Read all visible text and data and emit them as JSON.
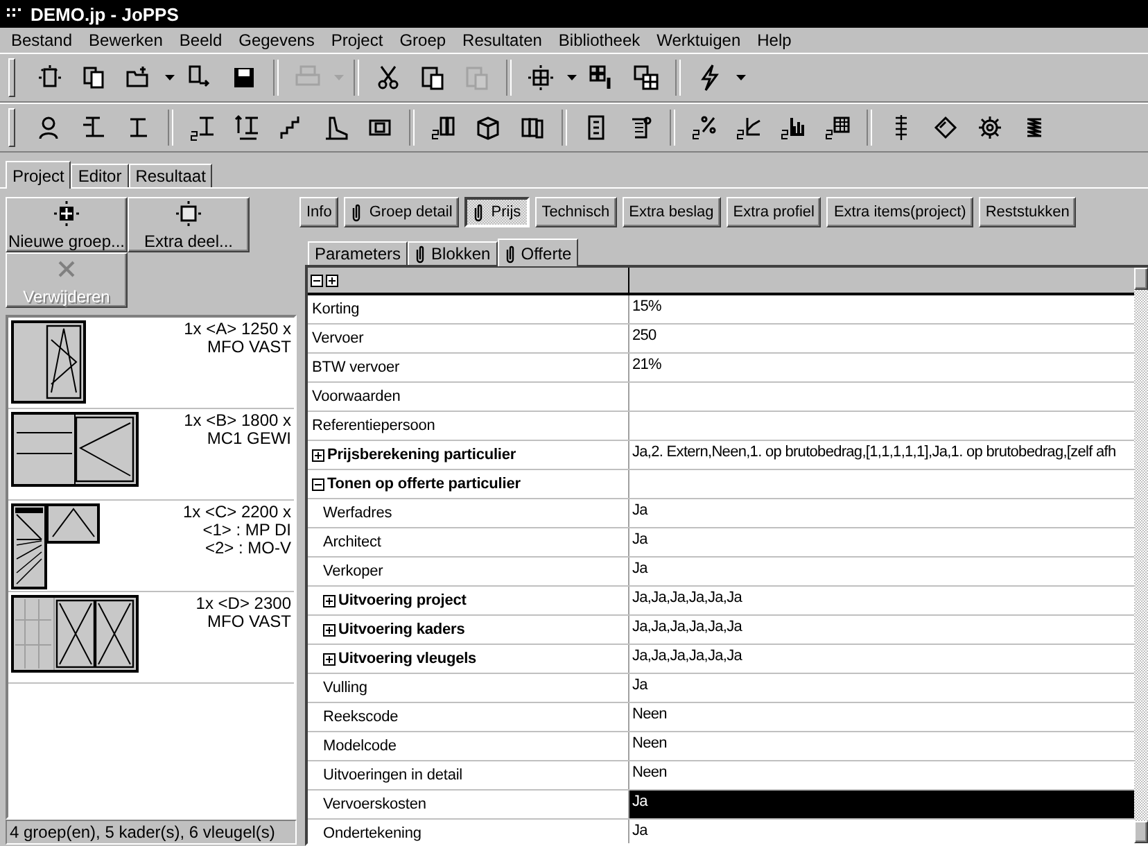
{
  "window": {
    "title": "DEMO.jp - JoPPS"
  },
  "menu": [
    "Bestand",
    "Bewerken",
    "Beeld",
    "Gegevens",
    "Project",
    "Groep",
    "Resultaten",
    "Bibliotheek",
    "Werktuigen",
    "Help"
  ],
  "toolbar_1": [
    {
      "kind": "new",
      "disabled": false
    },
    {
      "kind": "copy",
      "disabled": false
    },
    {
      "kind": "open",
      "disabled": false
    },
    {
      "kind": "dropdown",
      "disabled": false
    },
    {
      "kind": "import",
      "disabled": false
    },
    {
      "kind": "save",
      "disabled": false
    },
    {
      "kind": "sep"
    },
    {
      "kind": "print",
      "disabled": true
    },
    {
      "kind": "dropdown",
      "disabled": true
    },
    {
      "kind": "sep"
    },
    {
      "kind": "cut",
      "disabled": false
    },
    {
      "kind": "paste",
      "disabled": false
    },
    {
      "kind": "paste",
      "disabled": true
    },
    {
      "kind": "sep"
    },
    {
      "kind": "grid-new",
      "disabled": false
    },
    {
      "kind": "dropdown",
      "disabled": false
    },
    {
      "kind": "grid-info",
      "disabled": false
    },
    {
      "kind": "grid-multi",
      "disabled": false
    },
    {
      "kind": "sep"
    },
    {
      "kind": "lightning",
      "disabled": false
    },
    {
      "kind": "dropdown",
      "disabled": false
    }
  ],
  "toolbar_2": [
    {
      "kind": "person"
    },
    {
      "kind": "profile-frame"
    },
    {
      "kind": "profile"
    },
    {
      "kind": "sep"
    },
    {
      "kind": "price-profile"
    },
    {
      "kind": "size-profile"
    },
    {
      "kind": "stairs"
    },
    {
      "kind": "shoe"
    },
    {
      "kind": "frame"
    },
    {
      "kind": "sep"
    },
    {
      "kind": "price-bars"
    },
    {
      "kind": "cube"
    },
    {
      "kind": "rolls"
    },
    {
      "kind": "sep"
    },
    {
      "kind": "document"
    },
    {
      "kind": "scroll"
    },
    {
      "kind": "sep"
    },
    {
      "kind": "price-percent"
    },
    {
      "kind": "price-line"
    },
    {
      "kind": "price-chart"
    },
    {
      "kind": "price-grid"
    },
    {
      "kind": "sep"
    },
    {
      "kind": "list"
    },
    {
      "kind": "diamond"
    },
    {
      "kind": "gear"
    },
    {
      "kind": "spring"
    }
  ],
  "main_tabs": [
    {
      "label": "Project",
      "selected": true
    },
    {
      "label": "Editor",
      "selected": false
    },
    {
      "label": "Resultaat",
      "selected": false
    }
  ],
  "left_buttons": [
    {
      "label": "Nieuwe groep...",
      "kind": "grid",
      "disabled": false
    },
    {
      "label": "Extra deel...",
      "kind": "square",
      "disabled": false
    },
    {
      "label": "Verwijderen",
      "kind": "cross",
      "disabled": true
    }
  ],
  "groups": [
    {
      "kind": "tilt",
      "lines": [
        "1x <A> 1250 x",
        "MFO VAST"
      ]
    },
    {
      "kind": "slide",
      "lines": [
        "1x <B> 1800 x",
        "MC1 GEWI"
      ]
    },
    {
      "kind": "combo",
      "lines": [
        "1x <C> 2200 x",
        "<1> : MP DI",
        "<2> : MO-V"
      ]
    },
    {
      "kind": "double",
      "lines": [
        "1x <D> 2300",
        "MFO VAST"
      ]
    }
  ],
  "status_bar": "4 groep(en), 5 kader(s), 6 vleugel(s)",
  "detail_buttons": [
    {
      "label": "Info",
      "clip": false,
      "selected": false
    },
    {
      "label": "Groep detail",
      "clip": true,
      "selected": false
    },
    {
      "label": "Prijs",
      "clip": true,
      "selected": true
    },
    {
      "label": "Technisch",
      "clip": false,
      "selected": false
    },
    {
      "label": "Extra beslag",
      "clip": false,
      "selected": false
    },
    {
      "label": "Extra profiel",
      "clip": false,
      "selected": false
    },
    {
      "label": "Extra items(project)",
      "clip": false,
      "selected": false
    },
    {
      "label": "Reststukken",
      "clip": false,
      "selected": false
    }
  ],
  "sub_tabs": [
    {
      "label": "Parameters",
      "clip": false,
      "selected": false
    },
    {
      "label": "Blokken",
      "clip": true,
      "selected": false
    },
    {
      "label": "Offerte",
      "clip": true,
      "selected": true
    }
  ],
  "grid": {
    "rows": [
      {
        "kind": "property",
        "label": "Korting",
        "value": "15%",
        "selected": false
      },
      {
        "kind": "property",
        "label": "Vervoer",
        "value": "250",
        "selected": false
      },
      {
        "kind": "property",
        "label": "BTW vervoer",
        "value": "21%",
        "selected": false
      },
      {
        "kind": "property",
        "label": "Voorwaarden",
        "selected": false
      },
      {
        "kind": "property",
        "label": "Referentiepersoon",
        "selected": false
      },
      {
        "kind": "group",
        "label": "Prijsberekening particulier",
        "value": "Ja,2. Extern,Neen,1. op brutobedrag,[1,1,1,1,1],Ja,1. op brutobedrag,[zelf afh",
        "expanded": false,
        "selected": false
      },
      {
        "kind": "group",
        "label": "Tonen op offerte particulier",
        "expanded": true,
        "selected": false,
        "children": [
          {
            "kind": "property",
            "label": "Werfadres",
            "value": "Ja",
            "selected": false
          },
          {
            "kind": "property",
            "label": "Architect",
            "value": "Ja",
            "selected": false
          },
          {
            "kind": "property",
            "label": "Verkoper",
            "value": "Ja",
            "selected": false
          },
          {
            "kind": "group",
            "label": "Uitvoering project",
            "value": "Ja,Ja,Ja,Ja,Ja,Ja",
            "expanded": false,
            "selected": false
          },
          {
            "kind": "group",
            "label": "Uitvoering kaders",
            "value": "Ja,Ja,Ja,Ja,Ja,Ja",
            "expanded": false,
            "selected": false
          },
          {
            "kind": "group",
            "label": "Uitvoering vleugels",
            "value": "Ja,Ja,Ja,Ja,Ja,Ja",
            "expanded": false,
            "selected": false
          },
          {
            "kind": "property",
            "label": "Vulling",
            "value": "Ja",
            "selected": false
          },
          {
            "kind": "property",
            "label": "Reekscode",
            "value": "Neen",
            "selected": false
          },
          {
            "kind": "property",
            "label": "Modelcode",
            "value": "Neen",
            "selected": false
          },
          {
            "kind": "property",
            "label": "Uitvoeringen in detail",
            "value": "Neen",
            "selected": false
          },
          {
            "kind": "property",
            "label": "Vervoerskosten",
            "value": "Ja",
            "selected": true
          },
          {
            "kind": "property",
            "label": "Ondertekening",
            "value": "Ja",
            "selected": false
          }
        ]
      }
    ]
  }
}
